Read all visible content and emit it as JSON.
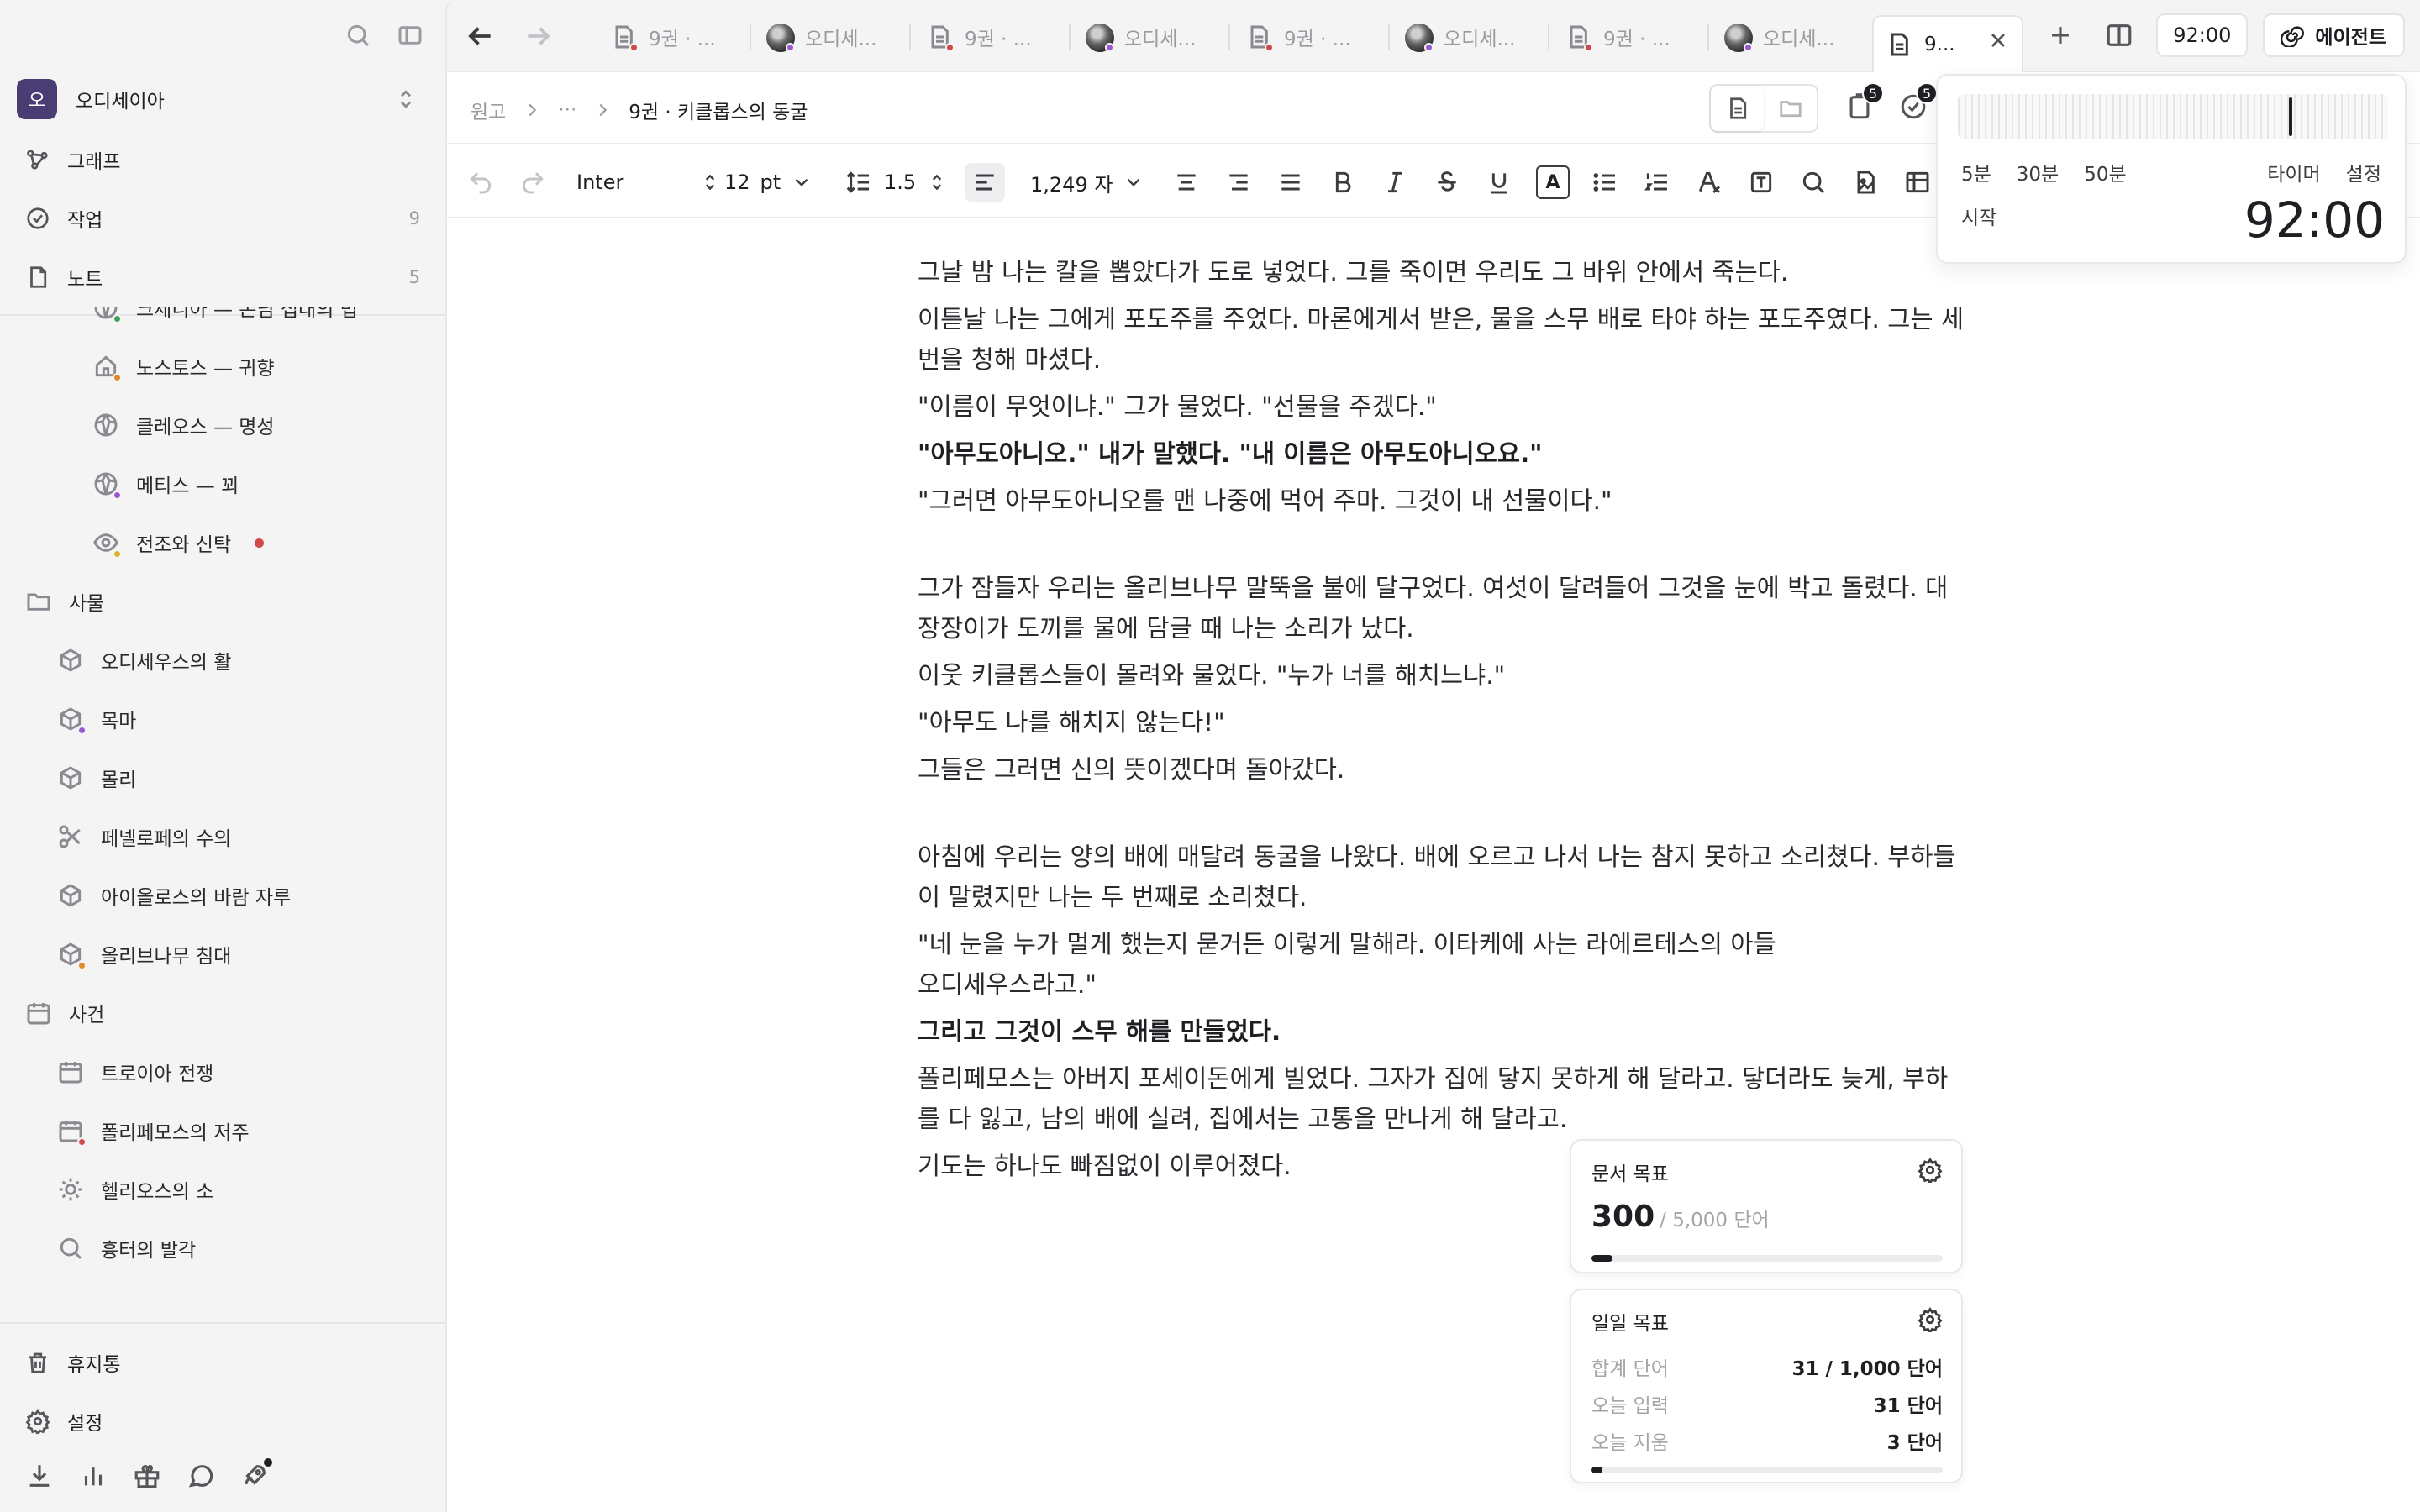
{
  "workspace": {
    "initial": "오",
    "name": "오디세이아"
  },
  "nav": [
    {
      "label": "그래프",
      "icon": "graph-icon"
    },
    {
      "label": "작업",
      "icon": "check-circle-icon",
      "count": "9"
    },
    {
      "label": "노트",
      "icon": "note-icon",
      "count": "5"
    }
  ],
  "tree": {
    "characters": [
      {
        "label": "크세니아 — 손님 접대의 법",
        "dot": "#3aa65a"
      },
      {
        "label": "노스토스 — 귀향",
        "dot": "#e08a2c"
      },
      {
        "label": "클레오스 — 명성",
        "dot": ""
      },
      {
        "label": "메티스 — 꾀",
        "dot": "#9b59d0"
      },
      {
        "label": "전조와 신탁",
        "dot": "#e0b02c"
      }
    ],
    "things_label": "사물",
    "things": [
      {
        "label": "오디세우스의 활",
        "icon": "cube-icon",
        "dot": ""
      },
      {
        "label": "목마",
        "icon": "cube-icon",
        "dot": "#9b59d0"
      },
      {
        "label": "몰리",
        "icon": "cube-icon",
        "dot": ""
      },
      {
        "label": "페넬로페의 수의",
        "icon": "scissors-icon",
        "dot": ""
      },
      {
        "label": "아이올로스의 바람 자루",
        "icon": "cube-icon",
        "dot": ""
      },
      {
        "label": "올리브나무 침대",
        "icon": "cube-icon",
        "dot": "#e08a2c"
      }
    ],
    "events_label": "사건",
    "events": [
      {
        "label": "트로이아 전쟁",
        "icon": "calendar-icon",
        "dot": ""
      },
      {
        "label": "폴리페모스의 저주",
        "icon": "calendar-icon",
        "dot": "#d04a4a"
      },
      {
        "label": "헬리오스의 소",
        "icon": "sun-icon",
        "dot": ""
      },
      {
        "label": "흉터의 발각",
        "icon": "search-icon",
        "dot": ""
      }
    ]
  },
  "sidebar_bottom": {
    "trash": "휴지통",
    "settings": "설정"
  },
  "tabs": [
    {
      "label": "9권 · ...",
      "kind": "doc",
      "dot": "#d04a4a"
    },
    {
      "label": "오디세...",
      "kind": "avatar"
    },
    {
      "label": "9권 · ...",
      "kind": "doc",
      "dot": "#d04a4a"
    },
    {
      "label": "오디세...",
      "kind": "avatar"
    },
    {
      "label": "9권 · ...",
      "kind": "doc",
      "dot": "#d04a4a"
    },
    {
      "label": "오디세...",
      "kind": "avatar"
    },
    {
      "label": "9권 · ...",
      "kind": "doc",
      "dot": "#d04a4a"
    },
    {
      "label": "오디세...",
      "kind": "avatar"
    },
    {
      "label": "9...",
      "kind": "doc",
      "active": true
    }
  ],
  "topbar": {
    "timer": "92:00",
    "agent": "에이전트"
  },
  "breadcrumb": {
    "root": "원고",
    "ellipsis": "···",
    "current": "9권 · 키클롭스의 동굴"
  },
  "badges": {
    "pages": "5",
    "tasks": "5"
  },
  "toolbar": {
    "font": "Inter",
    "size": "12",
    "unit": "pt",
    "line_spacing": "1.5",
    "char_count": "1,249 자",
    "color_letter": "A"
  },
  "editor": {
    "paragraphs": [
      {
        "text": "그날 밤 나는 칼을 뽑았다가 도로 넣었다. 그를 죽이면 우리도 그 바위 안에서 죽는다."
      },
      {
        "text": "이튿날 나는 그에게 포도주를 주었다. 마론에게서 받은, 물을 스무 배로 타야 하는 포도주였다. 그는 세 번을 청해 마셨다."
      },
      {
        "text": "\"이름이 무엇이냐.\" 그가 물었다. \"선물을 주겠다.\""
      },
      {
        "text": "\"아무도아니오.\" 내가 말했다. \"내 이름은 아무도아니오요.\"",
        "bold": true
      },
      {
        "text": "\"그러면 아무도아니오를 맨 나중에 먹어 주마. 그것이 내 선물이다.\""
      },
      {
        "gap": true
      },
      {
        "text": "그가 잠들자 우리는 올리브나무 말뚝을 불에 달구었다. 여섯이 달려들어 그것을 눈에 박고 돌렸다. 대장장이가 도끼를 물에 담글 때 나는 소리가 났다."
      },
      {
        "text": "이웃 키클롭스들이 몰려와 물었다. \"누가 너를 해치느냐.\""
      },
      {
        "text": "\"아무도 나를 해치지 않는다!\""
      },
      {
        "text": "그들은 그러면 신의 뜻이겠다며 돌아갔다."
      },
      {
        "gap": true
      },
      {
        "text": "아침에 우리는 양의 배에 매달려 동굴을 나왔다. 배에 오르고 나서 나는 참지 못하고 소리쳤다. 부하들이 말렸지만 나는 두 번째로 소리쳤다."
      },
      {
        "text": "\"네 눈을 누가 멀게 했는지 묻거든 이렇게 말해라. 이타케에 사는 라에르테스의 아들\n오디세우스라고.\""
      },
      {
        "text": "그리고 그것이 스무 해를 만들었다.",
        "bold": true
      },
      {
        "text": "폴리페모스는 아버지 포세이돈에게 빌었다. 그자가 집에 닿지 못하게 해 달라고. 닿더라도 늦게, 부하를 다 잃고, 남의 배에 실려, 집에서는 고통을 만나게 해 달라고."
      },
      {
        "text": "기도는 하나도 빠짐없이 이루어졌다."
      }
    ]
  },
  "timer_popover": {
    "presets": [
      "5분",
      "30분",
      "50분"
    ],
    "timer_link": "타이머",
    "settings_link": "설정",
    "start": "시작",
    "time": "92:00"
  },
  "doc_goal": {
    "title": "문서 목표",
    "value": "300",
    "target": "/ 5,000 단어",
    "progress": 0.06
  },
  "daily_goal": {
    "title": "일일 목표",
    "rows": [
      {
        "k": "합계 단어",
        "v": "31 / 1,000 단어"
      },
      {
        "k": "오늘 입력",
        "v": "31 단어"
      },
      {
        "k": "오늘 지움",
        "v": "3 단어"
      }
    ],
    "progress": 0.031
  }
}
